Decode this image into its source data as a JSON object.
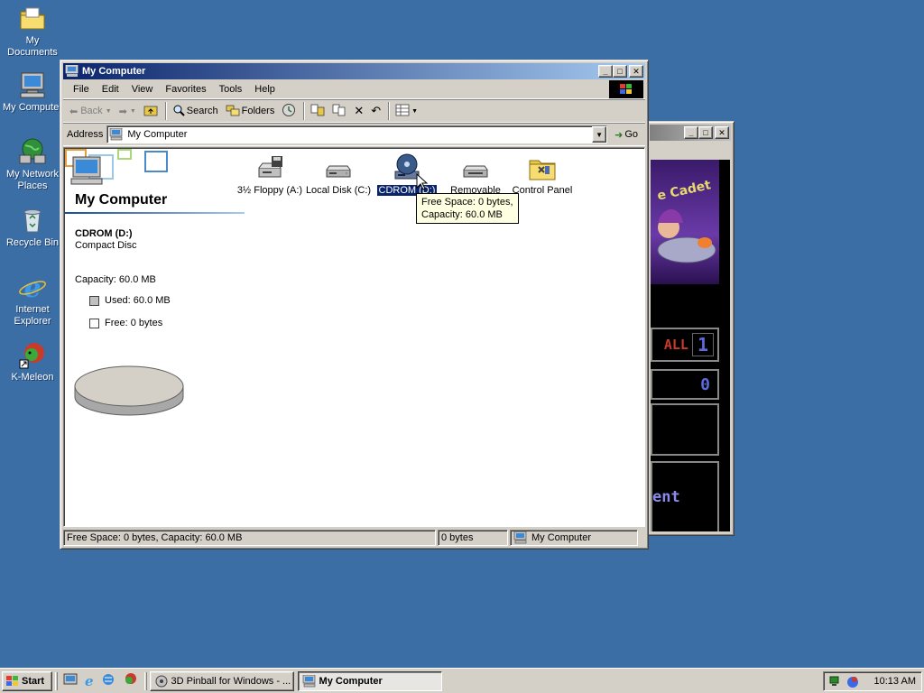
{
  "desktop": {
    "icons": [
      {
        "label": "My Documents"
      },
      {
        "label": "My Computer"
      },
      {
        "label": "My Network Places"
      },
      {
        "label": "Recycle Bin"
      },
      {
        "label": "Internet Explorer"
      },
      {
        "label": "K-Meleon"
      }
    ]
  },
  "window": {
    "title": "My Computer",
    "menu": [
      "File",
      "Edit",
      "View",
      "Favorites",
      "Tools",
      "Help"
    ],
    "toolbar": {
      "back": "Back",
      "search": "Search",
      "folders": "Folders"
    },
    "address": {
      "label": "Address",
      "value": "My Computer",
      "go": "Go"
    },
    "sidepanel": {
      "heading": "My Computer",
      "drive_name": "CDROM (D:)",
      "drive_type": "Compact Disc",
      "capacity": "Capacity: 60.0 MB",
      "used": "Used: 60.0 MB",
      "free": "Free: 0 bytes"
    },
    "items": [
      {
        "label": "3½ Floppy (A:)",
        "icon": "floppy-drive-icon"
      },
      {
        "label": "Local Disk (C:)",
        "icon": "hard-disk-icon"
      },
      {
        "label": "CDROM (D:)",
        "icon": "cdrom-icon",
        "selected": true
      },
      {
        "label": "Removable",
        "icon": "removable-disk-icon"
      },
      {
        "label": "Control Panel",
        "icon": "control-panel-icon"
      }
    ],
    "tooltip": {
      "line1": "Free Space: 0 bytes,",
      "line2": "Capacity: 60.0 MB"
    },
    "status": {
      "main": "Free Space: 0 bytes, Capacity: 60.0 MB",
      "size": "0 bytes",
      "zone": "My Computer"
    }
  },
  "pinball": {
    "ball_label": "ALL",
    "ball_number": "1",
    "score": "0",
    "banner": "ent"
  },
  "taskbar": {
    "start": "Start",
    "tasks": [
      {
        "label": "3D Pinball for Windows - ...",
        "pressed": false
      },
      {
        "label": "My Computer",
        "pressed": true
      }
    ],
    "clock": "10:13 AM"
  },
  "colors": {
    "desktop": "#3a6ea5",
    "title_active": "#0a246a",
    "selection": "#0a246a",
    "tooltip": "#ffffe1"
  }
}
